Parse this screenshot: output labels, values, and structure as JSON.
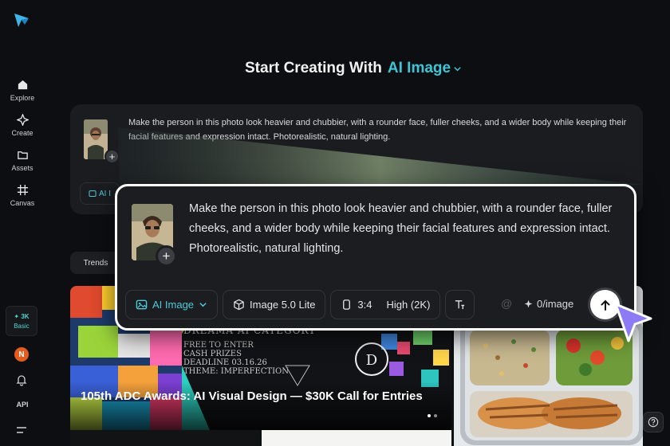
{
  "sidebar": {
    "items": [
      {
        "label": "Explore"
      },
      {
        "label": "Create"
      },
      {
        "label": "Assets"
      },
      {
        "label": "Canvas"
      }
    ],
    "plan": {
      "credits": "✦ 3K",
      "tier": "Basic"
    },
    "avatar_initial": "N",
    "api_label": "API"
  },
  "heading": {
    "prefix": "Start Creating With",
    "mode": "AI Image"
  },
  "prompt": {
    "text": "Make the person in this photo look heavier and chubbier, with a rounder face, fuller cheeks, and a wider body while keeping their facial features and expression intact. Photorealistic, natural lighting.",
    "bg_chip": "AI I"
  },
  "toolbar": {
    "mode": "AI Image",
    "model": "Image 5.0 Lite",
    "ratio": "3:4",
    "quality": "High (2K)",
    "at": "@",
    "cost": "0/image"
  },
  "tabs": {
    "trends": "Trends"
  },
  "gallery": {
    "featured_title": "105th ADC Awards: AI Visual Design — $30K Call for Entries",
    "poster_lines": [
      "DREAMA AI CATEGORY",
      "FREE TO ENTER",
      "CASH PRIZES",
      "DEADLINE 03.16.26",
      "THEME: IMPERFECTION"
    ]
  },
  "colors": {
    "accent": "#3fc6d6",
    "cursor": "#8b7cf6",
    "avatar": "#e25b1f"
  }
}
